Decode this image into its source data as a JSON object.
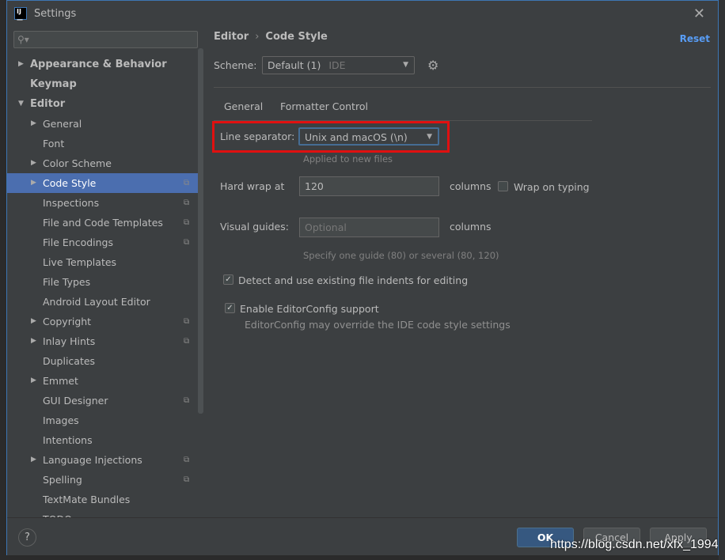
{
  "window": {
    "title": "Settings",
    "logo": "IJ"
  },
  "sidebar": {
    "search_placeholder": "",
    "items": [
      {
        "label": "Appearance & Behavior",
        "arrow": "▶",
        "bold": true
      },
      {
        "label": "Keymap",
        "bold": true
      },
      {
        "label": "Editor",
        "arrow": "▼",
        "bold": true
      },
      {
        "label": "General",
        "arrow": "▶"
      },
      {
        "label": "Font"
      },
      {
        "label": "Color Scheme",
        "arrow": "▶"
      },
      {
        "label": "Code Style",
        "arrow": "▶",
        "selected": true,
        "copy": true
      },
      {
        "label": "Inspections",
        "copy": true
      },
      {
        "label": "File and Code Templates",
        "copy": true
      },
      {
        "label": "File Encodings",
        "copy": true
      },
      {
        "label": "Live Templates"
      },
      {
        "label": "File Types"
      },
      {
        "label": "Android Layout Editor"
      },
      {
        "label": "Copyright",
        "arrow": "▶",
        "copy": true
      },
      {
        "label": "Inlay Hints",
        "arrow": "▶",
        "copy": true
      },
      {
        "label": "Duplicates"
      },
      {
        "label": "Emmet",
        "arrow": "▶"
      },
      {
        "label": "GUI Designer",
        "copy": true
      },
      {
        "label": "Images"
      },
      {
        "label": "Intentions"
      },
      {
        "label": "Language Injections",
        "arrow": "▶",
        "copy": true
      },
      {
        "label": "Spelling",
        "copy": true
      },
      {
        "label": "TextMate Bundles"
      },
      {
        "label": "TODO"
      }
    ]
  },
  "breadcrumb": {
    "parent": "Editor",
    "sep": "›",
    "current": "Code Style"
  },
  "reset_label": "Reset",
  "scheme": {
    "label": "Scheme:",
    "value": "Default (1)",
    "suffix": "IDE"
  },
  "tabs": [
    {
      "label": "General",
      "active": true
    },
    {
      "label": "Formatter Control"
    }
  ],
  "general": {
    "line_separator_label": "Line separator:",
    "line_separator_value": "Unix and macOS (\\n)",
    "line_separator_hint": "Applied to new files",
    "hard_wrap_label": "Hard wrap at",
    "hard_wrap_value": "120",
    "columns": "columns",
    "wrap_on_typing": "Wrap on typing",
    "wrap_on_typing_checked": false,
    "visual_guides_label": "Visual guides:",
    "visual_guides_placeholder": "Optional",
    "visual_guides_hint": "Specify one guide (80) or several (80, 120)",
    "detect_indents": "Detect and use existing file indents for editing",
    "detect_indents_checked": true,
    "editorconfig": "Enable EditorConfig support",
    "editorconfig_checked": true,
    "editorconfig_hint": "EditorConfig may override the IDE code style settings"
  },
  "footer": {
    "help": "?",
    "ok": "OK",
    "cancel": "Cancel",
    "apply": "Apply"
  },
  "watermark": "https://blog.csdn.net/xfx_1994",
  "colors": {
    "accent": "#4b6eaf",
    "highlight_box": "#e01010",
    "link": "#589df6"
  }
}
